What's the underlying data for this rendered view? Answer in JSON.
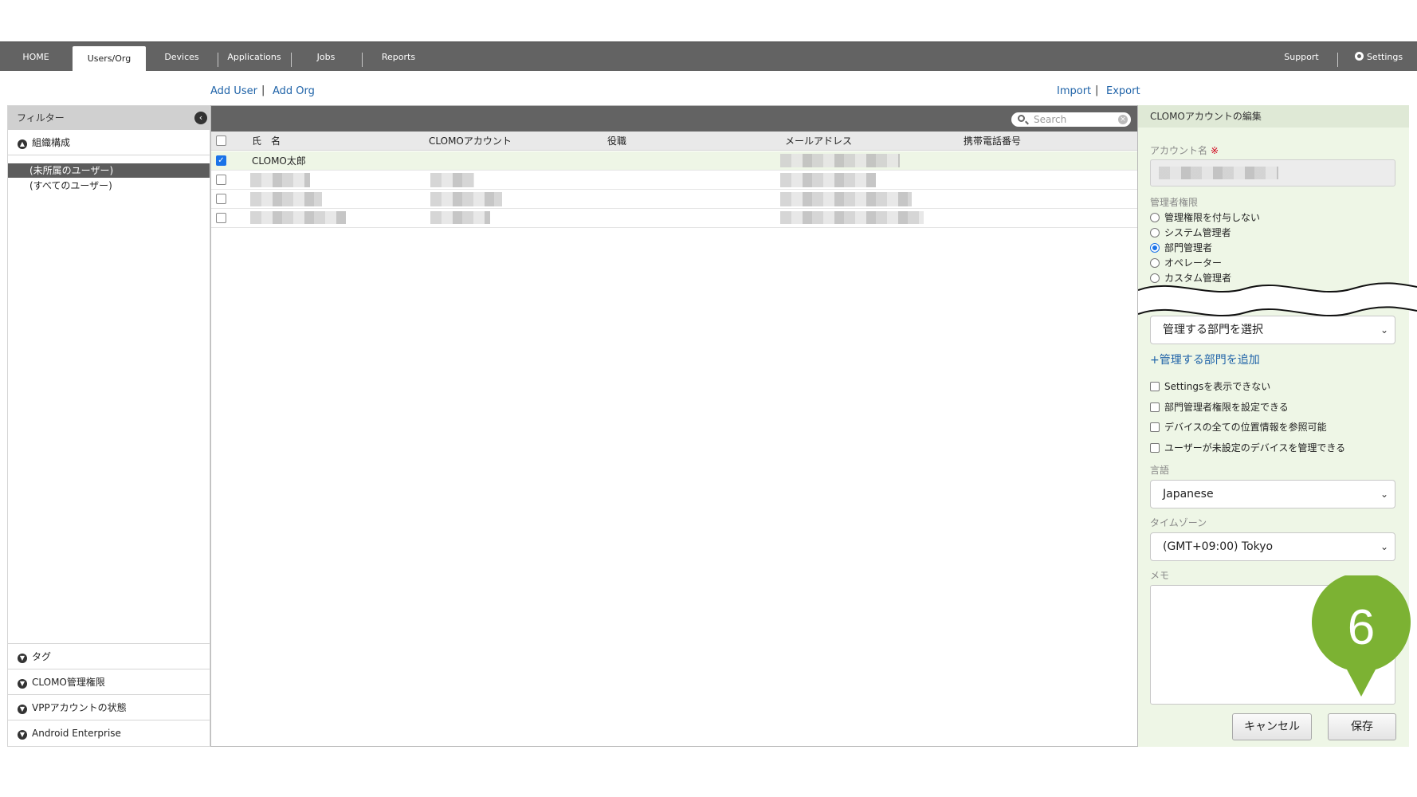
{
  "nav": {
    "home": "HOME",
    "users_org": "Users/Org",
    "devices": "Devices",
    "applications": "Applications",
    "jobs": "Jobs",
    "reports": "Reports",
    "support": "Support",
    "settings": "Settings"
  },
  "actions": {
    "add_user": "Add User",
    "add_org": "Add Org",
    "import": "Import",
    "export": "Export",
    "separator": "|"
  },
  "filter": {
    "title": "フィルター",
    "org_section": "組織構成",
    "org_items": [
      "(未所属のユーザー)",
      "(すべてのユーザー)"
    ],
    "bottom_sections": [
      "タグ",
      "CLOMO管理権限",
      "VPPアカウントの状態",
      "Android Enterprise"
    ]
  },
  "table": {
    "search_placeholder": "Search",
    "columns": [
      "氏　名",
      "CLOMOアカウント",
      "役職",
      "メールアドレス",
      "携帯電話番号"
    ],
    "rows": [
      {
        "name": "CLOMO太郎",
        "checked": true
      },
      {
        "name": "",
        "checked": false
      },
      {
        "name": "",
        "checked": false
      },
      {
        "name": "",
        "checked": false
      }
    ]
  },
  "edit_panel": {
    "title": "CLOMOアカウントの編集",
    "account_label": "アカウント名",
    "required_mark": "※",
    "admin_label": "管理者権限",
    "admin_options": [
      "管理権限を付与しない",
      "システム管理者",
      "部門管理者",
      "オペレーター",
      "カスタム管理者"
    ],
    "admin_selected_index": 2,
    "dept_select": "管理する部門を選択",
    "add_dept_link": "+管理する部門を追加",
    "checkbox_options": [
      "Settingsを表示できない",
      "部門管理者権限を設定できる",
      "デバイスの全ての位置情報を参照可能",
      "ユーザーが未設定のデバイスを管理できる"
    ],
    "language_label": "言語",
    "language_value": "Japanese",
    "timezone_label": "タイムゾーン",
    "timezone_value": "(GMT+09:00) Tokyo",
    "memo_label": "メモ",
    "cancel": "キャンセル",
    "save": "保存"
  },
  "step_marker": {
    "number": "6",
    "color": "#7cb233"
  },
  "colors": {
    "nav_bg": "#636363",
    "panel_green": "#eef6e6",
    "link_blue": "#1f63a8",
    "check_blue": "#1a73e8"
  }
}
